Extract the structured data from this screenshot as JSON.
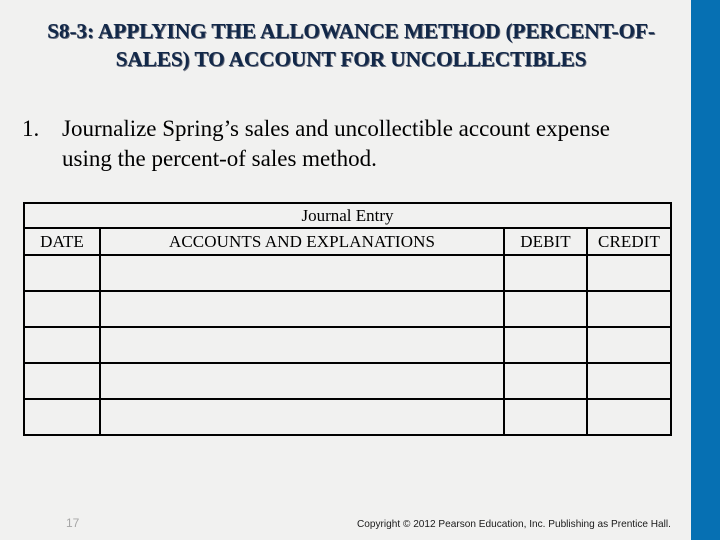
{
  "slide": {
    "title": "S8-3:  APPLYING  THE  ALLOWANCE  METHOD (PERCENT-OF-\nSALES) TO  ACCOUNT  FOR  UNCOLLECTIBLES",
    "accent_color": "#0670b3",
    "background_color": "#f1f1f0",
    "title_color": "#122849"
  },
  "body": {
    "bullets": [
      {
        "number": "1.",
        "text": "Journalize Spring’s sales and uncollectible account expense using the percent-of sales method."
      }
    ]
  },
  "table": {
    "caption": "Journal Entry",
    "columns": [
      "DATE",
      "ACCOUNTS AND EXPLANATIONS",
      "DEBIT",
      "CREDIT"
    ],
    "rows": [
      [
        "",
        "",
        "",
        ""
      ],
      [
        "",
        "",
        "",
        ""
      ],
      [
        "",
        "",
        "",
        ""
      ],
      [
        "",
        "",
        "",
        ""
      ],
      [
        "",
        "",
        "",
        ""
      ]
    ]
  },
  "footer": {
    "page_number": "17",
    "copyright": "Copyright © 2012 Pearson Education, Inc. Publishing as Prentice Hall."
  }
}
